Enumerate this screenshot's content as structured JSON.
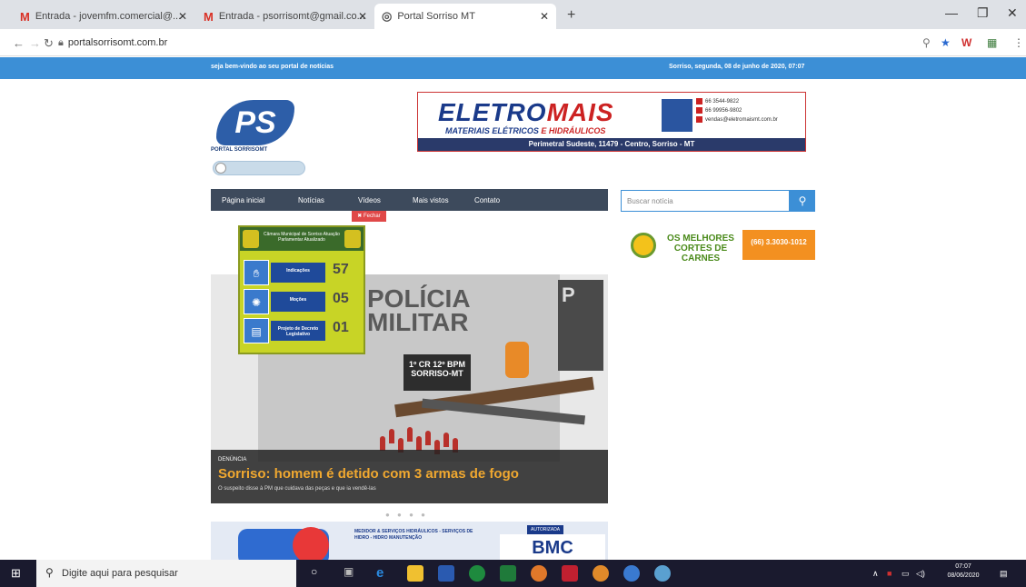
{
  "browser": {
    "tabs": [
      {
        "label": "Entrada - jovemfm.comercial@...",
        "icon": "gmail-icon"
      },
      {
        "label": "Entrada - psorrisomt@gmail.co...",
        "icon": "gmail-icon"
      },
      {
        "label": "Portal Sorriso MT",
        "icon": "globe-icon"
      }
    ],
    "url": "portalsorrisomt.com.br"
  },
  "site": {
    "welcome": "seja bem-vindo ao seu portal de notícias",
    "date": "Sorriso, segunda, 08 de junho de 2020, 07:07",
    "logo_text": "PS",
    "logo_name": "PORTAL SORRISOMT",
    "banner": {
      "brand_a": "ELETRO",
      "brand_b": "MAIS",
      "tagline_a": "MATERIAIS ELÉTRICOS",
      "tagline_b": "E HIDRÁULICOS",
      "address": "Perimetral Sudeste, 11479 - Centro, Sorriso - MT",
      "contacts": [
        "66 3544-9822",
        "66 99956-9802",
        "vendas@eletromaismt.com.br"
      ]
    },
    "menu": [
      "Página inicial",
      "Notícias",
      "Vídeos",
      "Mais vistos",
      "Contato"
    ],
    "close_label": "Fechar",
    "search_placeholder": "Buscar notícia",
    "ad_carnes": {
      "text": "OS MELHORES CORTES DE CARNES",
      "phone": "(66) 3.3030-1012"
    },
    "widget": {
      "header": "Câmara Municipal de Sorriso Atuação Parlamentar Atualizado",
      "rows": [
        {
          "label": "Indicações",
          "value": "57"
        },
        {
          "label": "Moções",
          "value": "05"
        },
        {
          "label": "Projeto de Decreto Legislativo",
          "value": "01"
        }
      ]
    },
    "hero": {
      "category": "DENÚNCIA",
      "title": "Sorriso: homem é detido com 3 armas de fogo",
      "subtitle": "O suspeito disse à PM que cuidava das peças e que ia vendê-las",
      "photo_text_a": "POLÍCIA",
      "photo_text_b": "MILITAR",
      "photo_badge": "1º CR 12º BPM SORRISO-MT"
    },
    "ad_bottom": {
      "text": "MEDIDOR & SERVIÇOS HIDRÁULICOS - SERVIÇOS DE HIDRO - HIDRO MANUTENÇÃO",
      "badge": "AUTORIZADA",
      "brand": "BMC"
    }
  },
  "taskbar": {
    "search_placeholder": "Digite aqui para pesquisar",
    "time": "07:07",
    "date": "08/06/2020"
  }
}
